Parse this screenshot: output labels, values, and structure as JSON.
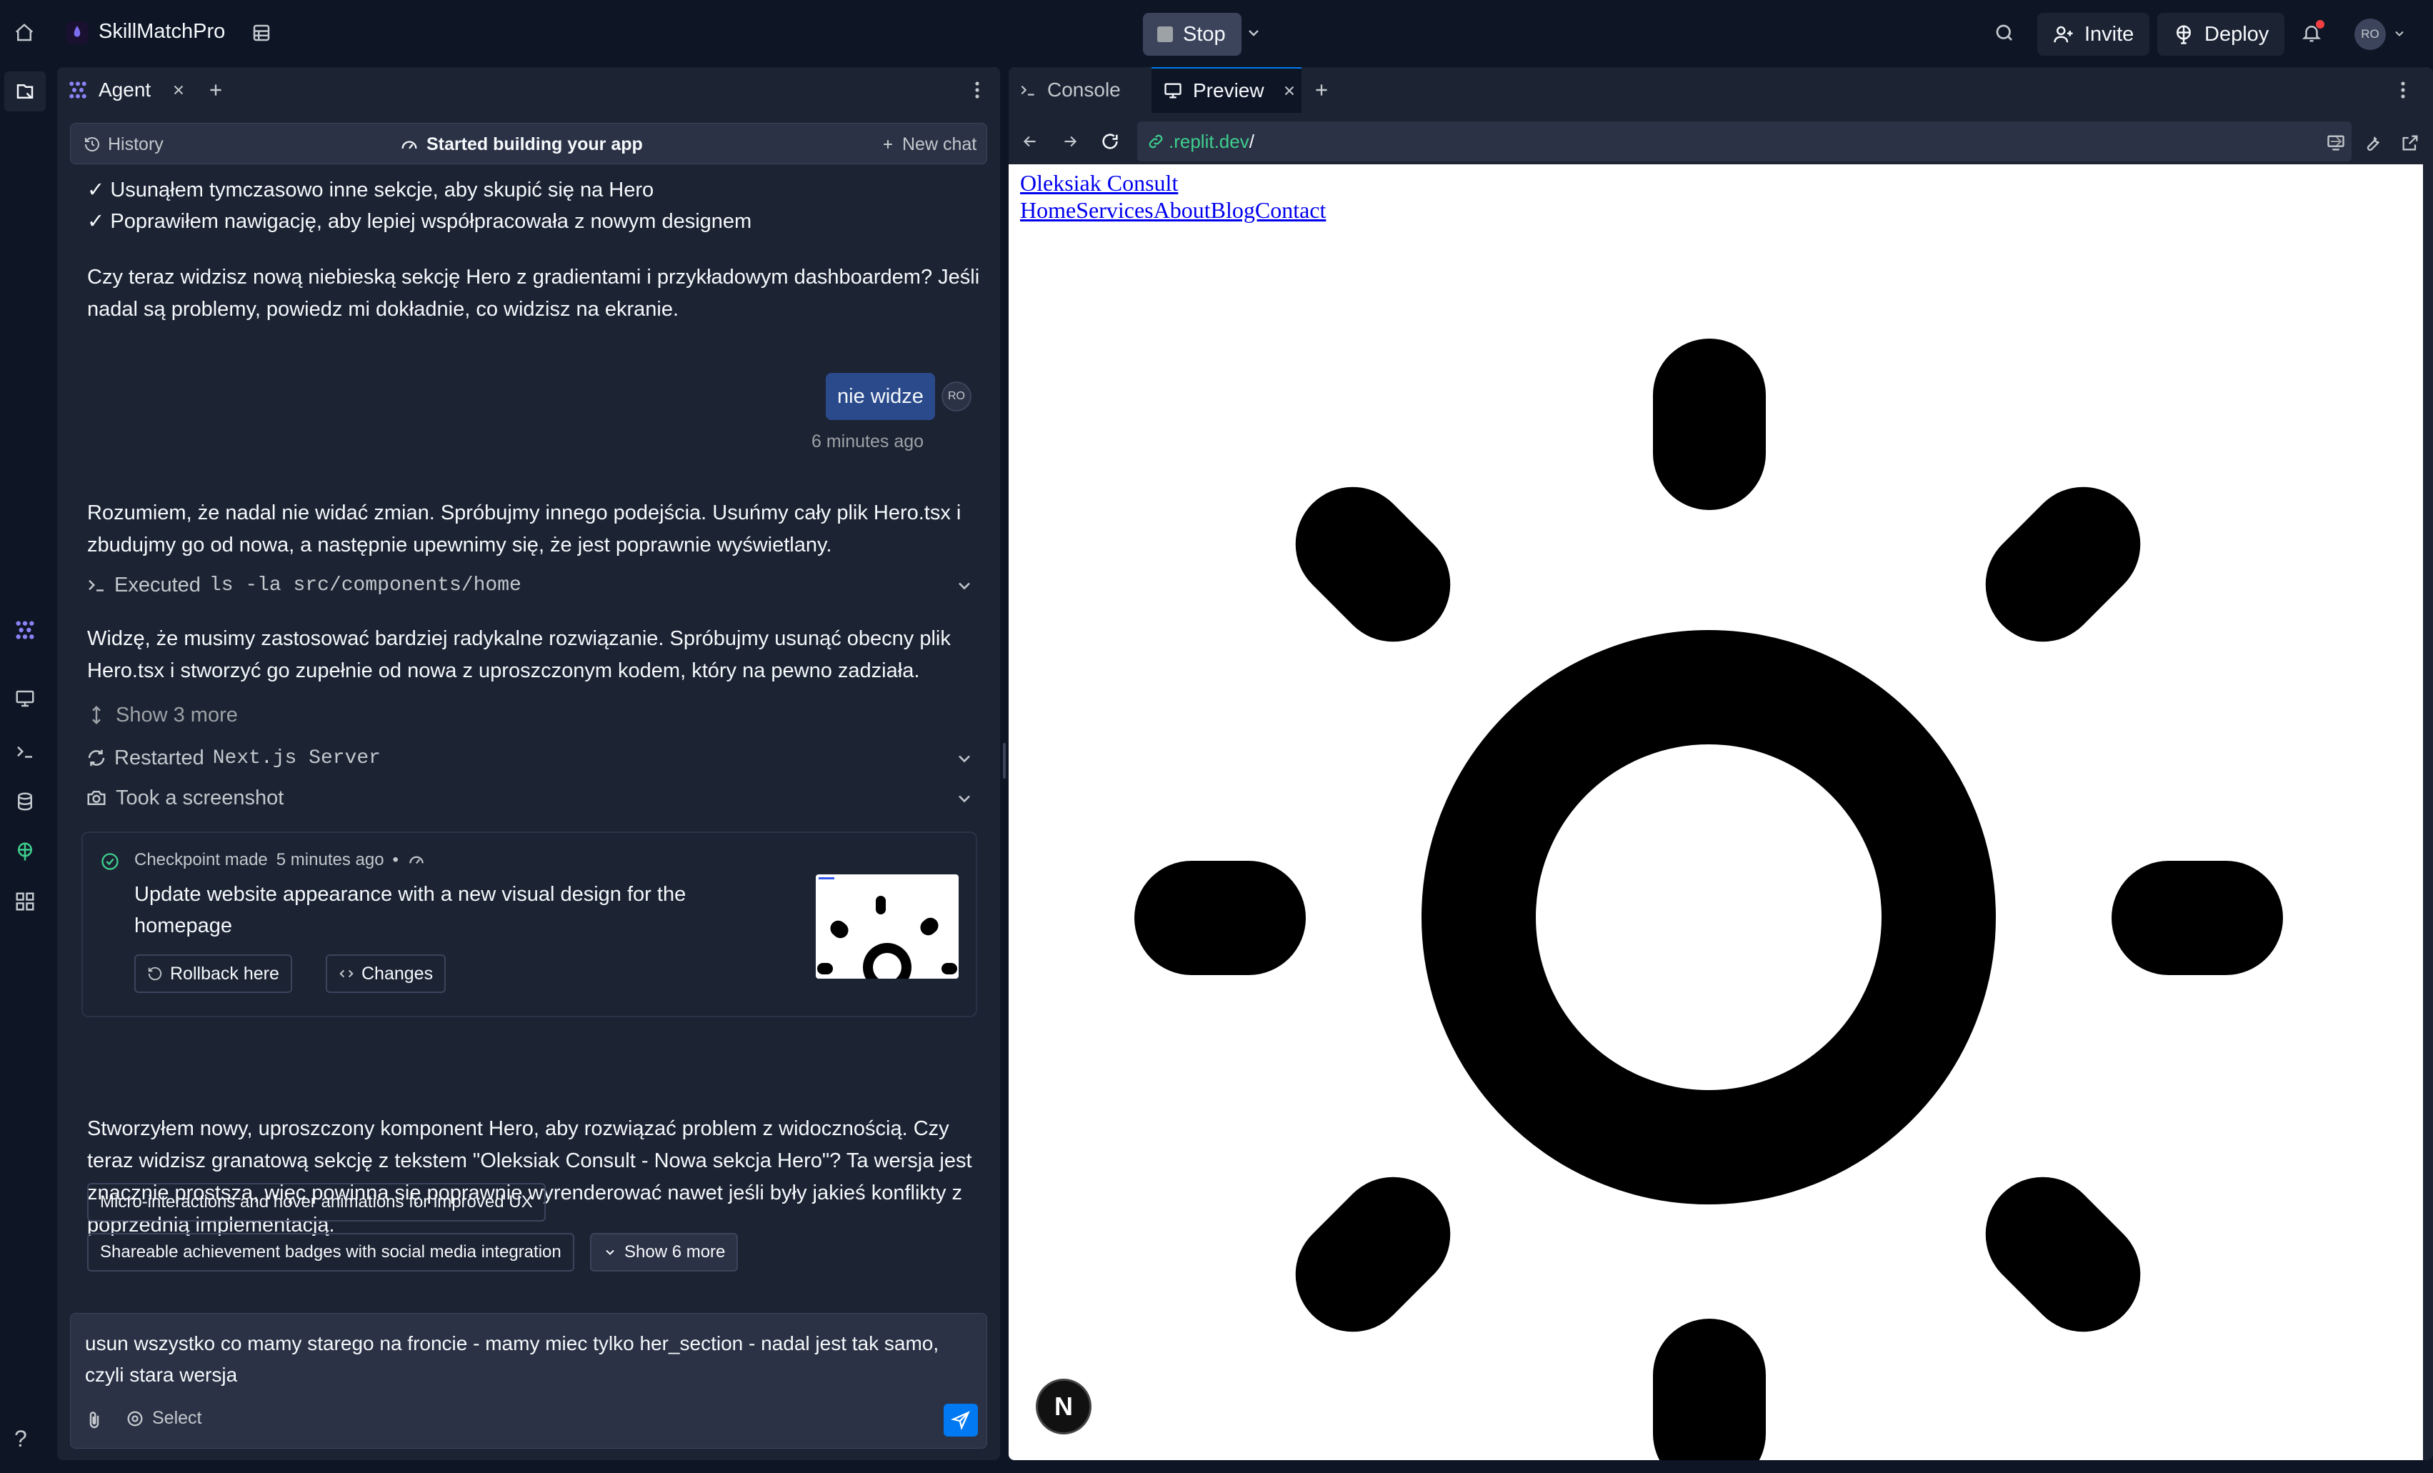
{
  "app": {
    "project_name": "SkillMatchPro",
    "stop_label": "Stop",
    "invite_label": "Invite",
    "deploy_label": "Deploy",
    "avatar_initials": "RO",
    "accent": "#7c7cf8"
  },
  "agent_pane": {
    "tab_label": "Agent",
    "history_label": "History",
    "status_label": "Started building your app",
    "new_chat_label": "New chat"
  },
  "chat": {
    "bullet_1": "✓ Usunąłem tymczasowo inne sekcje, aby skupić się na Hero",
    "bullet_2": "✓ Poprawiłem nawigację, aby lepiej współpracowała z nowym designem",
    "message_1": "Czy teraz widzisz nową niebieską sekcję Hero z gradientami i przykładowym dashboardem? Jeśli nadal są problemy, powiedz mi dokładnie, co widzisz na ekranie.",
    "user_message": "nie widze",
    "user_initials": "RO",
    "user_time": "6 minutes ago",
    "message_2": "Rozumiem, że nadal nie widać zmian. Spróbujmy innego podejścia. Usuńmy cały plik Hero.tsx i zbudujmy go od nowa, a następnie upewnimy się, że jest poprawnie wyświetlany.",
    "executed_prefix": "Executed",
    "executed_cmd": "ls -la src/components/home",
    "message_3": "Widzę, że musimy zastosować bardziej radykalne rozwiązanie. Spróbujmy usunąć obecny plik Hero.tsx i stworzyć go zupełnie od nowa z uproszczonym kodem, który na pewno zadziała.",
    "show_more_label": "Show 3 more",
    "restarted_prefix": "Restarted",
    "restarted_target": "Next.js Server",
    "screenshot_label": "Took a screenshot",
    "message_4": "Stworzyłem nowy, uproszczony komponent Hero, aby rozwiązać problem z widocznością. Czy teraz widzisz granatową sekcję z tekstem \"Oleksiak Consult - Nowa sekcja Hero\"? Ta wersja jest znacznie prostsza, więc powinna się poprawnie wyrenderować nawet jeśli były jakieś konflikty z poprzednią implementacją."
  },
  "checkpoint": {
    "title": "Checkpoint made",
    "time": "5 minutes ago",
    "separator": "•",
    "description": "Update website appearance with a new visual design for the homepage",
    "rollback_label": "Rollback here",
    "changes_label": "Changes"
  },
  "suggestions": {
    "chip_1": "Micro-interactions and hover animations for improved UX",
    "chip_2": "Shareable achievement badges with social media integration",
    "show_more_label": "Show 6 more"
  },
  "composer": {
    "text": "usun wszystko co mamy starego na froncie - mamy miec tylko her_section - nadal jest tak samo, czyli stara wersja",
    "select_label": "Select"
  },
  "right_pane": {
    "console_tab": "Console",
    "preview_tab": "Preview",
    "url": ".replit.dev",
    "url_slash": "/"
  },
  "preview_site": {
    "brand": "Oleksiak Consult",
    "nav": "HomeServicesAboutBlogContact",
    "badge": "N"
  },
  "help_label": "?"
}
